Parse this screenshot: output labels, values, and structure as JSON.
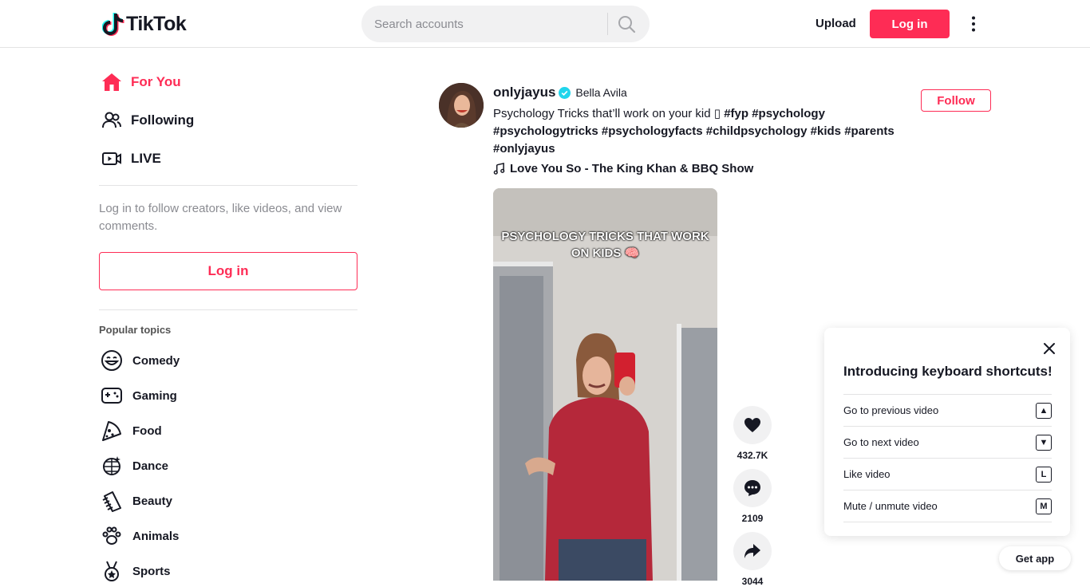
{
  "header": {
    "logo_text": "TikTok",
    "search_placeholder": "Search accounts",
    "upload_label": "Upload",
    "login_label": "Log in"
  },
  "sidebar": {
    "nav": [
      {
        "label": "For You",
        "icon": "home-icon",
        "active": true
      },
      {
        "label": "Following",
        "icon": "people-icon"
      },
      {
        "label": "LIVE",
        "icon": "live-icon"
      }
    ],
    "login_hint": "Log in to follow creators, like videos, and view comments.",
    "login_button": "Log in",
    "topics_title": "Popular topics",
    "topics": [
      {
        "label": "Comedy",
        "icon": "smile-icon"
      },
      {
        "label": "Gaming",
        "icon": "gamepad-icon"
      },
      {
        "label": "Food",
        "icon": "pizza-icon"
      },
      {
        "label": "Dance",
        "icon": "disco-ball-icon"
      },
      {
        "label": "Beauty",
        "icon": "comb-icon"
      },
      {
        "label": "Animals",
        "icon": "paw-icon"
      },
      {
        "label": "Sports",
        "icon": "medal-icon"
      }
    ]
  },
  "post": {
    "username": "onlyjayus",
    "nickname": "Bella Avila",
    "caption_text": "Psychology Tricks that’ll work on your kid ▯",
    "hashtags": [
      "#fyp",
      "#psychology",
      "#psychologytricks",
      "#psychologyfacts",
      "#childpsychology",
      "#kids",
      "#parents",
      "#onlyjayus"
    ],
    "music": "Love You So - The King Khan & BBQ Show",
    "follow_label": "Follow",
    "video_overlay_text": "PSYCHOLOGY TRICKS THAT WORK ON KIDS 🧠",
    "likes": "432.7K",
    "comments": "2109",
    "shares": "3044"
  },
  "shortcuts": {
    "title": "Introducing keyboard shortcuts!",
    "items": [
      {
        "label": "Go to previous video",
        "key": "▲"
      },
      {
        "label": "Go to next video",
        "key": "▼"
      },
      {
        "label": "Like video",
        "key": "L"
      },
      {
        "label": "Mute / unmute video",
        "key": "M"
      }
    ]
  },
  "get_app_label": "Get app",
  "colors": {
    "accent": "#fe2c55",
    "text": "#161823",
    "muted": "#8a8b91",
    "verified": "#20d5ec"
  }
}
